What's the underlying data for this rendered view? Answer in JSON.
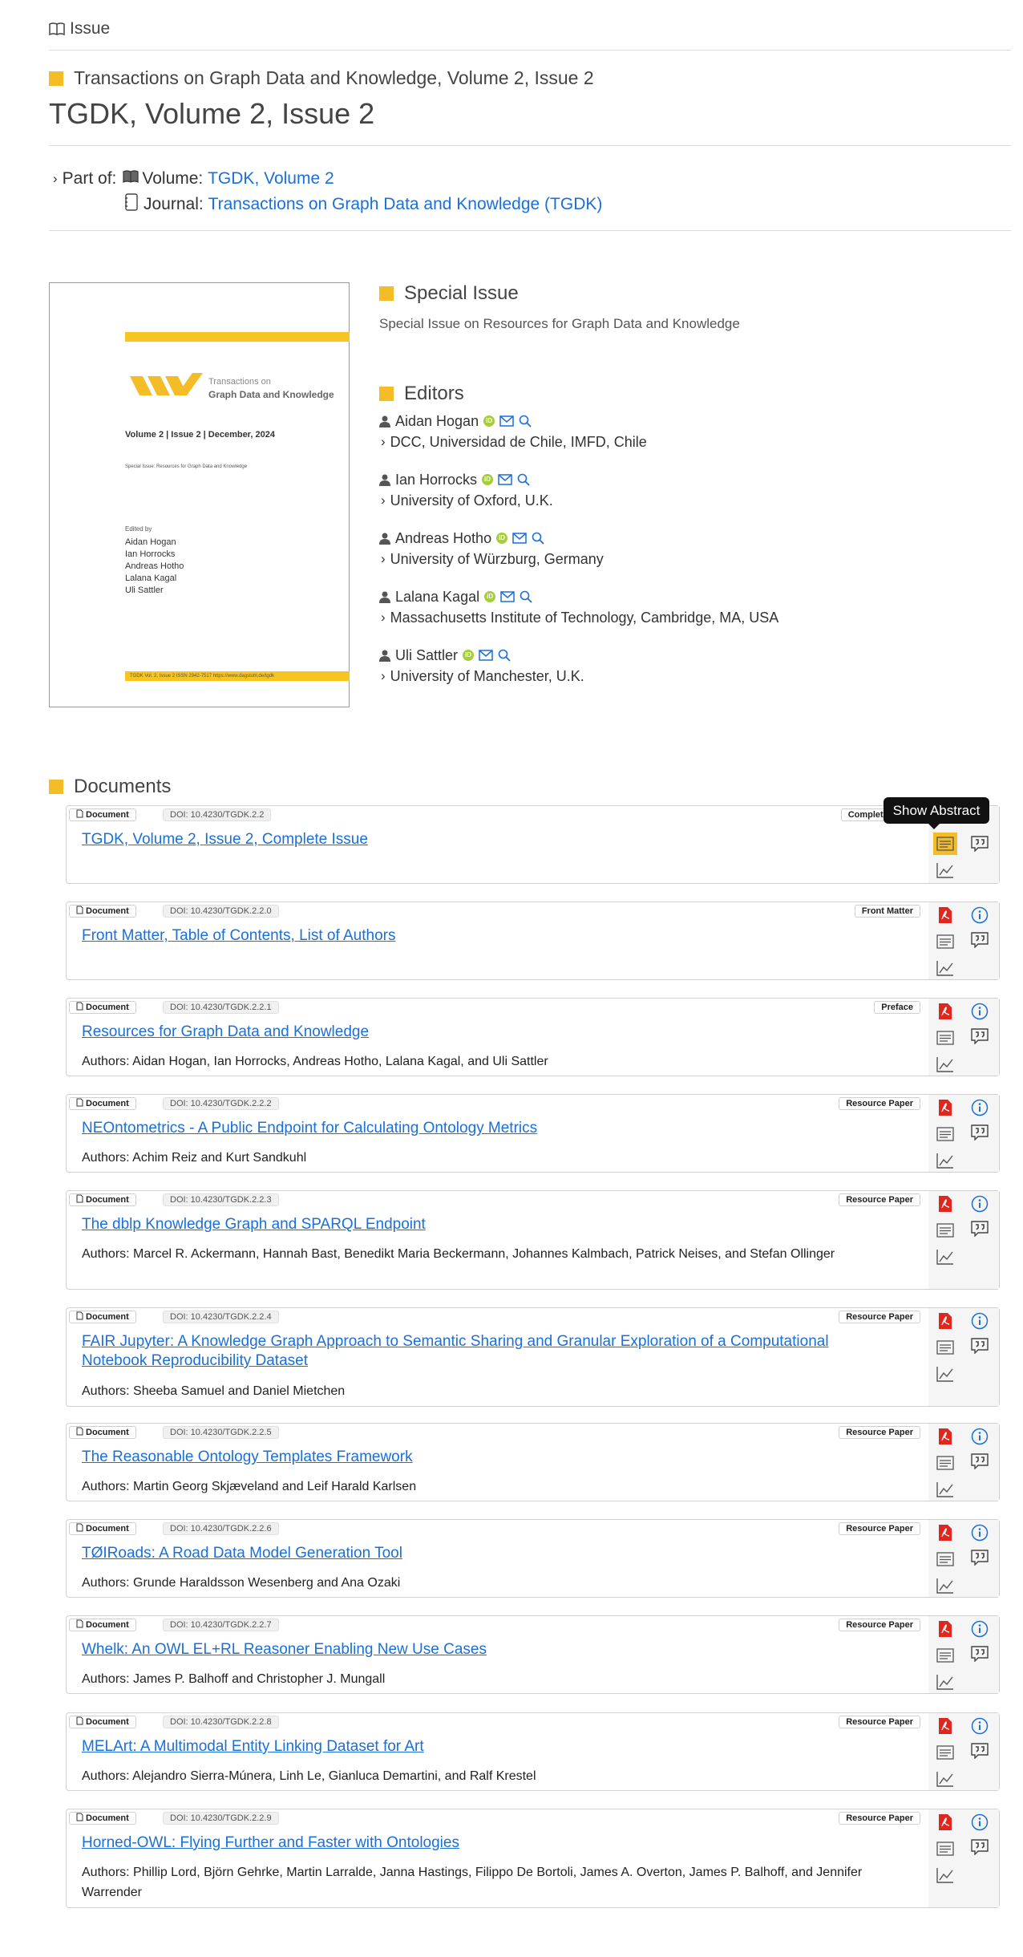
{
  "breadcrumb": {
    "label": "Issue"
  },
  "header": {
    "series": "Transactions on Graph Data and Knowledge, Volume 2, Issue 2",
    "title": "TGDK, Volume 2, Issue 2"
  },
  "part_of": {
    "prefix": "Part of:",
    "volume_label": "Volume:",
    "volume_link": "TGDK, Volume 2",
    "journal_label": "Journal:",
    "journal_link": "Transactions on Graph Data and Knowledge (TGDK)"
  },
  "cover": {
    "logo_line1": "Transactions on",
    "logo_line2": "Graph Data and Knowledge",
    "volume_line": "Volume 2 | Issue 2 | December, 2024",
    "special_issue": "Special Issue: Resources for Graph Data and Knowledge",
    "edited_by": "Edited by",
    "editors": [
      "Aidan Hogan",
      "Ian Horrocks",
      "Andreas Hotho",
      "Lalana Kagal",
      "Uli Sattler"
    ],
    "footer": "TGDK Vol. 2, Issue 2        ISSN 2942-7517        https://www.dagstuhl.de/tgdk"
  },
  "special_issue": {
    "heading": "Special Issue",
    "text": "Special Issue on Resources for Graph Data and Knowledge"
  },
  "editors": {
    "heading": "Editors",
    "list": [
      {
        "name": "Aidan Hogan",
        "affiliation": "DCC, Universidad de Chile, IMFD, Chile"
      },
      {
        "name": "Ian Horrocks",
        "affiliation": "University of Oxford, U.K."
      },
      {
        "name": "Andreas Hotho",
        "affiliation": "University of Würzburg, Germany"
      },
      {
        "name": "Lalana Kagal",
        "affiliation": "Massachusetts Institute of Technology, Cambridge, MA, USA"
      },
      {
        "name": "Uli Sattler",
        "affiliation": "University of Manchester, U.K."
      }
    ]
  },
  "documents": {
    "heading": "Documents",
    "tooltip": "Show Abstract",
    "kind_label": "Document",
    "items": [
      {
        "doi": "DOI: 10.4230/TGDK.2.2",
        "type": "Complete Issue",
        "title": "TGDK, Volume 2, Issue 2, Complete Issue",
        "authors": ""
      },
      {
        "doi": "DOI: 10.4230/TGDK.2.2.0",
        "type": "Front Matter",
        "title": "Front Matter, Table of Contents, List of Authors",
        "authors": ""
      },
      {
        "doi": "DOI: 10.4230/TGDK.2.2.1",
        "type": "Preface",
        "title": "Resources for Graph Data and Knowledge",
        "authors": "Authors: Aidan Hogan, Ian Horrocks, Andreas Hotho, Lalana Kagal, and Uli Sattler"
      },
      {
        "doi": "DOI: 10.4230/TGDK.2.2.2",
        "type": "Resource Paper",
        "title": "NEOntometrics - A Public Endpoint for Calculating Ontology Metrics",
        "authors": "Authors: Achim Reiz and Kurt Sandkuhl"
      },
      {
        "doi": "DOI: 10.4230/TGDK.2.2.3",
        "type": "Resource Paper",
        "title": "The dblp Knowledge Graph and SPARQL Endpoint",
        "authors": "Authors: Marcel R. Ackermann, Hannah Bast, Benedikt Maria Beckermann, Johannes Kalmbach, Patrick Neises, and Stefan Ollinger"
      },
      {
        "doi": "DOI: 10.4230/TGDK.2.2.4",
        "type": "Resource Paper",
        "title": "FAIR Jupyter: A Knowledge Graph Approach to Semantic Sharing and Granular Exploration of a Computational Notebook Reproducibility Dataset",
        "authors": "Authors: Sheeba Samuel and Daniel Mietchen"
      },
      {
        "doi": "DOI: 10.4230/TGDK.2.2.5",
        "type": "Resource Paper",
        "title": "The Reasonable Ontology Templates Framework",
        "authors": "Authors: Martin Georg Skjæveland and Leif Harald Karlsen"
      },
      {
        "doi": "DOI: 10.4230/TGDK.2.2.6",
        "type": "Resource Paper",
        "title": "TØIRoads: A Road Data Model Generation Tool",
        "authors": "Authors: Grunde Haraldsson Wesenberg and Ana Ozaki"
      },
      {
        "doi": "DOI: 10.4230/TGDK.2.2.7",
        "type": "Resource Paper",
        "title": "Whelk: An OWL EL+RL Reasoner Enabling New Use Cases",
        "authors": "Authors: James P. Balhoff and Christopher J. Mungall"
      },
      {
        "doi": "DOI: 10.4230/TGDK.2.2.8",
        "type": "Resource Paper",
        "title": "MELArt: A Multimodal Entity Linking Dataset for Art",
        "authors": "Authors: Alejandro Sierra-Múnera, Linh Le, Gianluca Demartini, and Ralf Krestel"
      },
      {
        "doi": "DOI: 10.4230/TGDK.2.2.9",
        "type": "Resource Paper",
        "title": "Horned-OWL: Flying Further and Faster with Ontologies",
        "authors": "Authors: Phillip Lord, Björn Gehrke, Martin Larralde, Janna Hastings, Filippo De Bortoli, James A. Overton, James P. Balhoff, and Jennifer Warrender"
      }
    ]
  },
  "colors": {
    "accent": "#f4bc26",
    "link": "#1a6fd9",
    "pdf": "#e0271f"
  }
}
